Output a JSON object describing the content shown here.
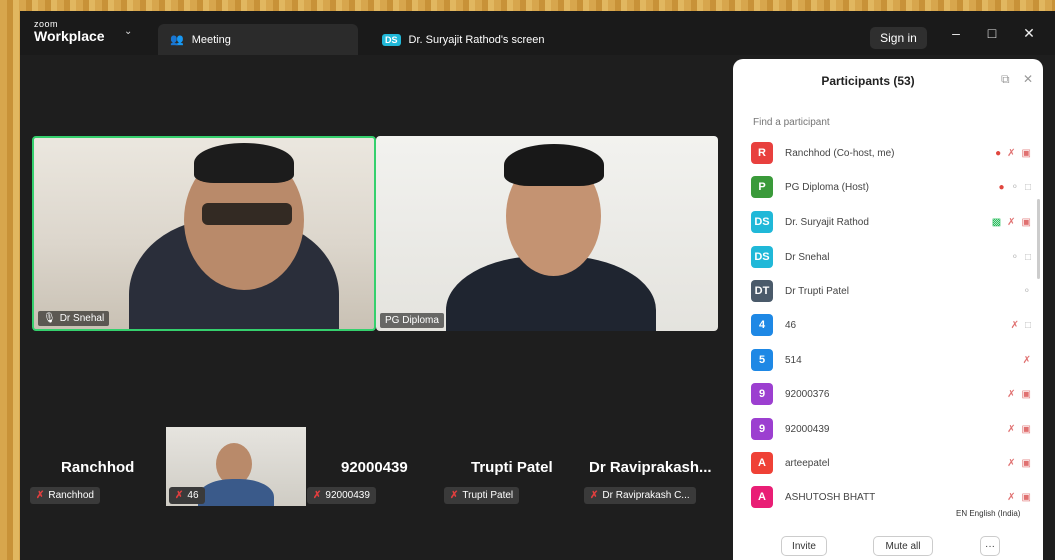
{
  "titlebar": {
    "logo_top": "zoom",
    "logo_bottom": "Workplace",
    "tab_meeting": "Meeting",
    "tab_screen_badge": "DS",
    "tab_screen": "Dr. Suryajit Rathod's screen",
    "sign_in": "Sign in"
  },
  "gallery": {
    "tile1_name": "Dr Snehal",
    "tile2_name": "PG Diploma"
  },
  "strip": {
    "names": [
      "Ranchhod",
      "92000439",
      "Trupti Patel",
      "Dr  Raviprakash..."
    ],
    "chips": [
      "Ranchhod",
      "46",
      "92000439",
      "Trupti Patel",
      "Dr Raviprakash C..."
    ]
  },
  "participants": {
    "title": "Participants (53)",
    "search_placeholder": "Find a participant",
    "rows": [
      {
        "initial": "R",
        "color": "#e8403e",
        "name": "Ranchhod (Co-host, me)"
      },
      {
        "initial": "P",
        "color": "#3a9a3a",
        "name": "PG Diploma (Host)"
      },
      {
        "initial": "DS",
        "color": "#20b8d8",
        "name": "Dr. Suryajit Rathod"
      },
      {
        "initial": "DS",
        "color": "#20b8d8",
        "name": "Dr Snehal"
      },
      {
        "initial": "DT",
        "color": "#4a5a6a",
        "name": "Dr Trupti Patel"
      },
      {
        "initial": "4",
        "color": "#1e88e5",
        "name": "46"
      },
      {
        "initial": "5",
        "color": "#1e88e5",
        "name": "514"
      },
      {
        "initial": "9",
        "color": "#9c3fd0",
        "name": "92000376"
      },
      {
        "initial": "9",
        "color": "#9c3fd0",
        "name": "92000439"
      },
      {
        "initial": "A",
        "color": "#ef4136",
        "name": "arteepatel"
      },
      {
        "initial": "A",
        "color": "#e91e75",
        "name": "ASHUTOSH BHATT"
      }
    ],
    "invite": "Invite",
    "mute_all": "Mute all",
    "more": "···"
  },
  "language": "EN English (India)"
}
